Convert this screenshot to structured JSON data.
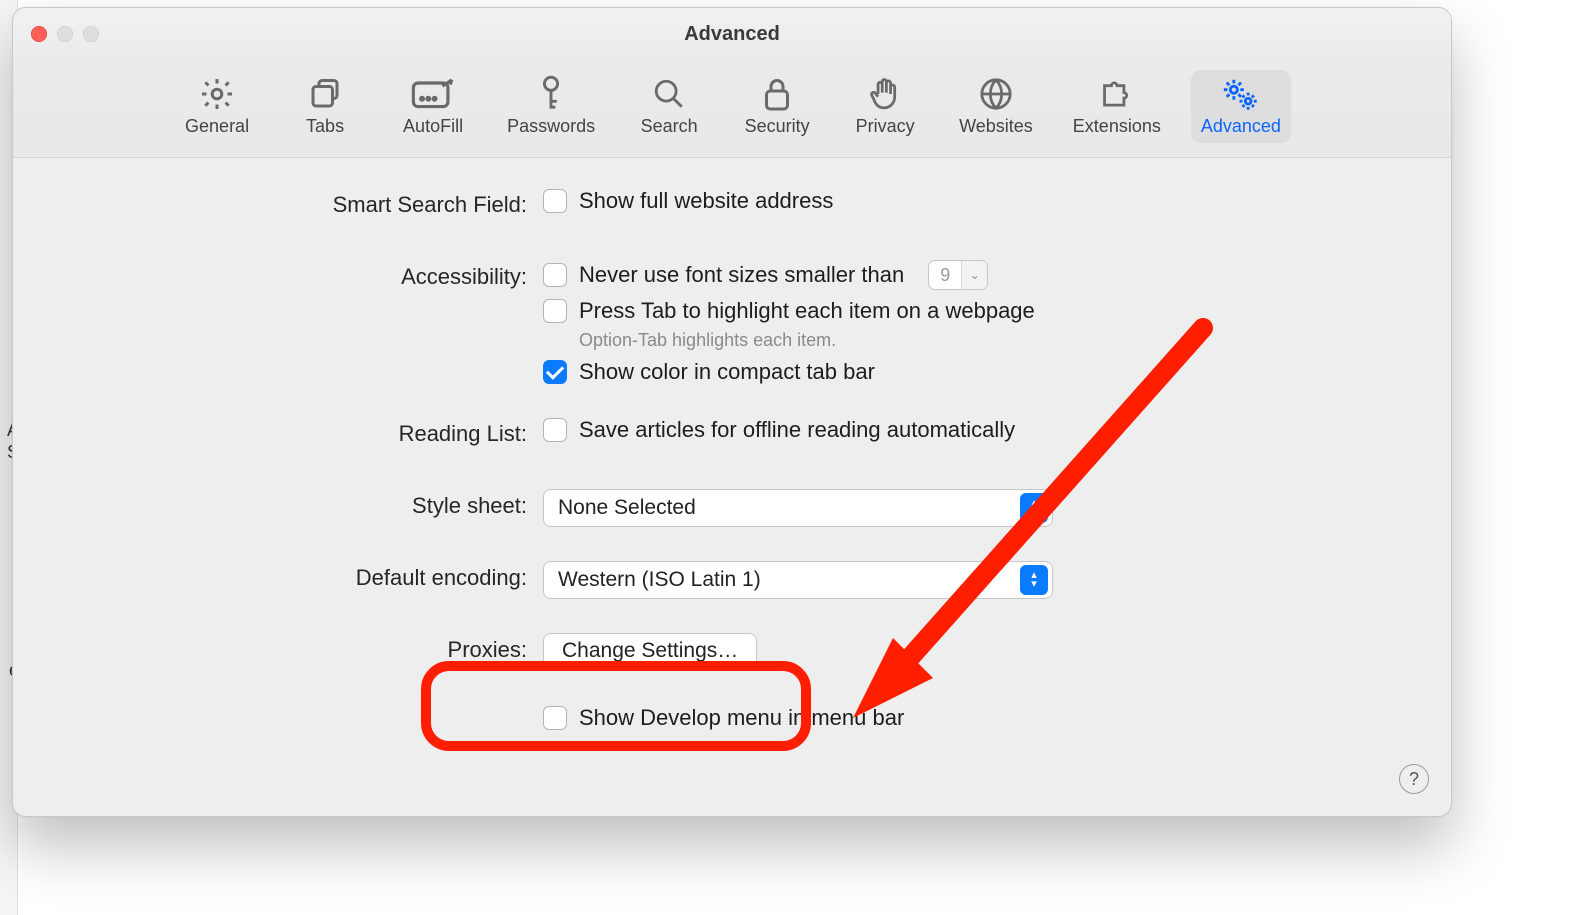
{
  "window": {
    "title": "Advanced"
  },
  "tabs": {
    "general": "General",
    "tabs": "Tabs",
    "autofill": "AutoFill",
    "passwords": "Passwords",
    "search": "Search",
    "security": "Security",
    "privacy": "Privacy",
    "websites": "Websites",
    "extensions": "Extensions",
    "advanced": "Advanced"
  },
  "labels": {
    "smart_search": "Smart Search Field:",
    "accessibility": "Accessibility:",
    "reading_list": "Reading List:",
    "style_sheet": "Style sheet:",
    "default_encoding": "Default encoding:",
    "proxies": "Proxies:"
  },
  "options": {
    "show_full_url": "Show full website address",
    "never_font_smaller": "Never use font sizes smaller than",
    "press_tab": "Press Tab to highlight each item on a webpage",
    "tab_hint": "Option-Tab highlights each item.",
    "compact_color": "Show color in compact tab bar",
    "offline_reading": "Save articles for offline reading automatically",
    "style_sheet_value": "None Selected",
    "encoding_value": "Western (ISO Latin 1)",
    "change_settings": "Change Settings…",
    "show_develop": "Show Develop menu in menu bar",
    "font_size_value": "9"
  },
  "help": "?"
}
